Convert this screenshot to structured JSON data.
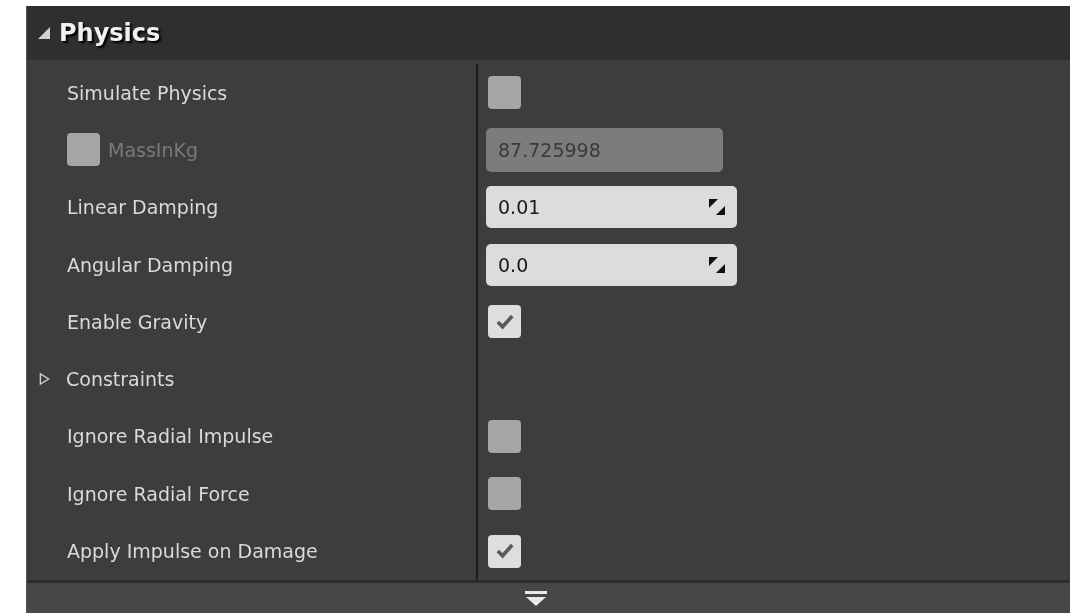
{
  "section": {
    "title": "Physics",
    "expanded": true
  },
  "rows": [
    {
      "kind": "checkbox",
      "label": "Simulate Physics",
      "checked": false
    },
    {
      "kind": "override",
      "label": "MassInKg",
      "checked": false,
      "value": "87.725998",
      "disabled": true
    },
    {
      "kind": "number",
      "label": "Linear Damping",
      "value": "0.01"
    },
    {
      "kind": "number",
      "label": "Angular Damping",
      "value": "0.0"
    },
    {
      "kind": "checkbox",
      "label": "Enable Gravity",
      "checked": true
    },
    {
      "kind": "group",
      "label": "Constraints",
      "expanded": false
    },
    {
      "kind": "checkbox",
      "label": "Ignore Radial Impulse",
      "checked": false
    },
    {
      "kind": "checkbox",
      "label": "Ignore Radial Force",
      "checked": false
    },
    {
      "kind": "checkbox",
      "label": "Apply Impulse on Damage",
      "checked": true
    }
  ]
}
